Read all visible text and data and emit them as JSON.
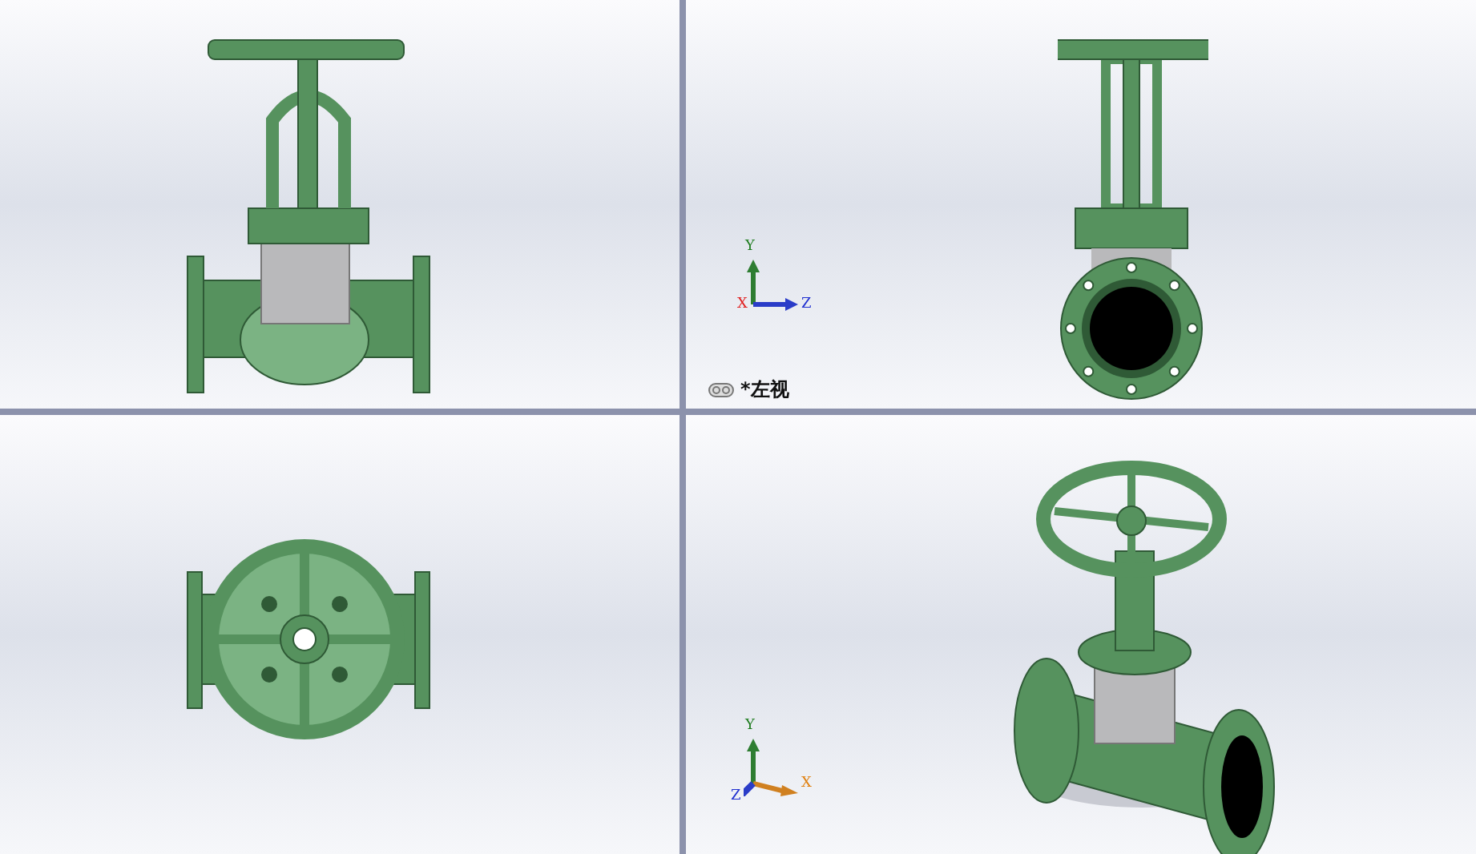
{
  "viewports": [
    {
      "kind": "front"
    },
    {
      "kind": "left",
      "triad": {
        "kind": "planar",
        "axes": [
          "Y",
          "Z",
          "X"
        ]
      },
      "label": "*左视"
    },
    {
      "kind": "top"
    },
    {
      "kind": "iso",
      "triad": {
        "kind": "iso",
        "axes": [
          "Y",
          "X",
          "Z"
        ]
      }
    }
  ]
}
